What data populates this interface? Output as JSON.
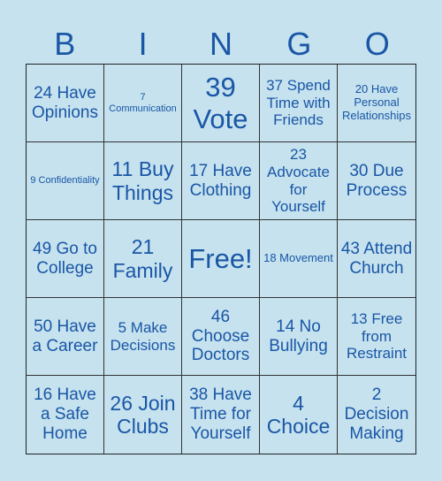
{
  "header": {
    "letters": [
      "B",
      "I",
      "N",
      "G",
      "O"
    ]
  },
  "colors": {
    "background": "#c5e2ee",
    "text": "#1a56a6",
    "grid_line": "#333333"
  },
  "cells": [
    {
      "text": "24 Have Opinions",
      "size": "lg"
    },
    {
      "text": "7 Communication",
      "size": "xs"
    },
    {
      "text": "39 Vote",
      "size": "xxl"
    },
    {
      "text": "37 Spend Time with Friends",
      "size": "md"
    },
    {
      "text": "20 Have Personal Relationships",
      "size": "sm"
    },
    {
      "text": "9 Confidentiality",
      "size": "xs"
    },
    {
      "text": "11 Buy Things",
      "size": "xl"
    },
    {
      "text": "17 Have Clothing",
      "size": "lg"
    },
    {
      "text": "23 Advocate for Yourself",
      "size": "md"
    },
    {
      "text": "30 Due Process",
      "size": "lg"
    },
    {
      "text": "49 Go to College",
      "size": "lg"
    },
    {
      "text": "21 Family",
      "size": "xl"
    },
    {
      "text": "Free!",
      "size": "xxl"
    },
    {
      "text": "18 Movement",
      "size": "sm"
    },
    {
      "text": "43 Attend Church",
      "size": "lg"
    },
    {
      "text": "50 Have a Career",
      "size": "lg"
    },
    {
      "text": "5 Make Decisions",
      "size": "md"
    },
    {
      "text": "46 Choose Doctors",
      "size": "lg"
    },
    {
      "text": "14 No Bullying",
      "size": "lg"
    },
    {
      "text": "13 Free from Restraint",
      "size": "md"
    },
    {
      "text": "16 Have a Safe Home",
      "size": "lg"
    },
    {
      "text": "26 Join Clubs",
      "size": "xl"
    },
    {
      "text": "38 Have Time for Yourself",
      "size": "lg"
    },
    {
      "text": "4 Choice",
      "size": "xl"
    },
    {
      "text": "2 Decision Making",
      "size": "lg"
    }
  ]
}
